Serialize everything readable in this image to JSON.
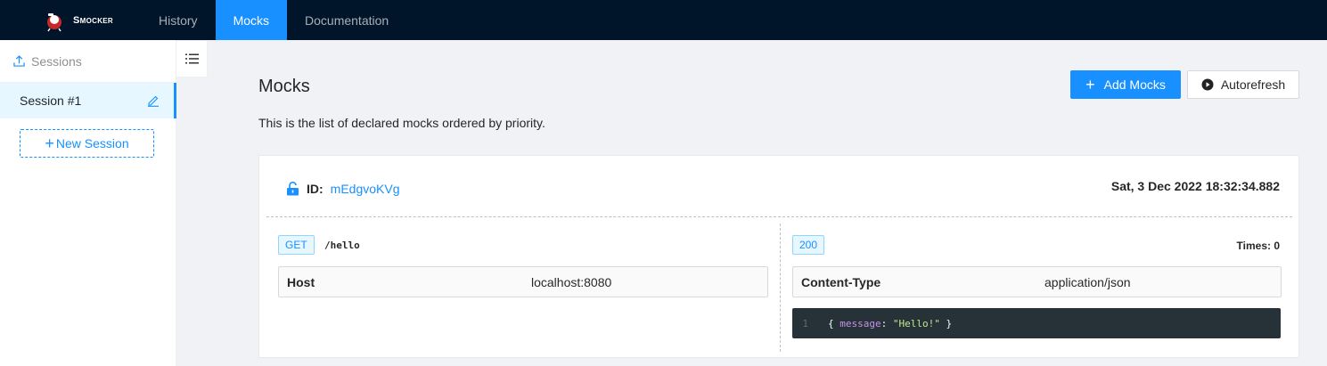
{
  "brand": {
    "name": "Smocker"
  },
  "nav": {
    "items": [
      "History",
      "Mocks",
      "Documentation"
    ],
    "active": "Mocks"
  },
  "sidebar": {
    "title": "Sessions",
    "sessions": [
      {
        "label": "Session #1"
      }
    ],
    "new_session_label": "New Session"
  },
  "main": {
    "title": "Mocks",
    "description": "This is the list of declared mocks ordered by priority.",
    "add_button_label": "Add Mocks",
    "autorefresh_button_label": "Autorefresh"
  },
  "mock": {
    "id_label": "ID:",
    "id": "mEdgvoKVg",
    "date": "Sat, 3 Dec 2022 18:32:34.882",
    "request": {
      "method": "GET",
      "path": "/hello",
      "header_key": "Host",
      "header_value": "localhost:8080"
    },
    "response": {
      "status": "200",
      "times": "Times: 0",
      "header_key": "Content-Type",
      "header_value": "application/json",
      "body_line_number": "1",
      "body_open": "{ ",
      "body_key": "message",
      "body_colon": ": ",
      "body_value": "\"Hello!\"",
      "body_close": " }"
    }
  },
  "colors": {
    "primary": "#1890ff",
    "header_bg": "#001529",
    "code_bg": "#263238"
  }
}
